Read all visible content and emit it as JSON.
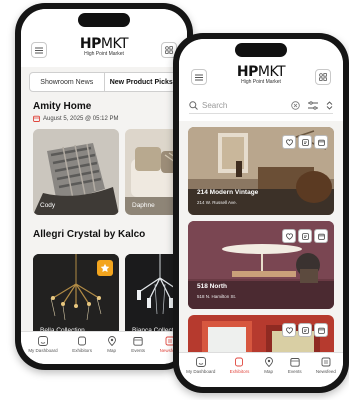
{
  "brand": {
    "logo_bold": "HP",
    "logo_rest": "MKT",
    "tagline": "High Point Market"
  },
  "left_phone": {
    "tabs": [
      "Showroom News",
      "New Product Picks"
    ],
    "sections": [
      {
        "title": "Amity Home",
        "date": "August 5, 2025 @ 05:12 PM",
        "cards": [
          "Cody",
          "Daphne"
        ]
      },
      {
        "title": "Allegri Crystal by Kalco",
        "cards": [
          "Bella Collection",
          "Bianca Collection"
        ]
      }
    ],
    "nav": [
      "My Dashboard",
      "Exhibitors",
      "Map",
      "Events",
      "Newsfeed"
    ]
  },
  "right_phone": {
    "search_placeholder": "Search",
    "exhibitors": [
      {
        "name": "214 Modern Vintage",
        "address": "214 W. Russell Ave."
      },
      {
        "name": "518 North",
        "address": "518 N. Hamilton St."
      }
    ],
    "nav": [
      "My Dashboard",
      "Exhibitors",
      "Map",
      "Events",
      "Newsfeed"
    ]
  },
  "colors": {
    "accent": "#e0463e",
    "badge": "#f3a51e"
  }
}
